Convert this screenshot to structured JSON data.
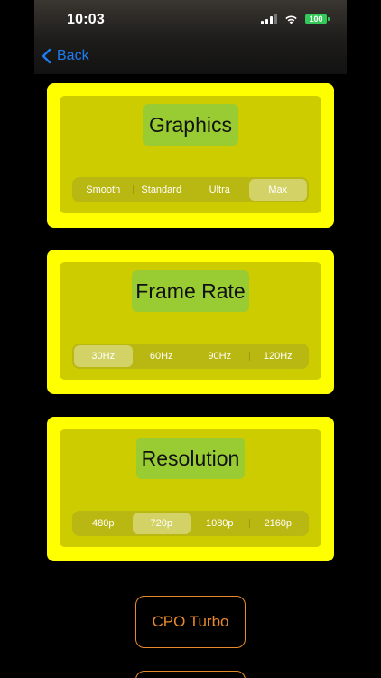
{
  "status": {
    "time": "10:03",
    "battery": "100"
  },
  "nav": {
    "back_label": "Back"
  },
  "sections": [
    {
      "title": "Graphics",
      "options": [
        "Smooth",
        "Standard",
        "Ultra",
        "Max"
      ],
      "selected": "Max"
    },
    {
      "title": "Frame Rate",
      "options": [
        "30Hz",
        "60Hz",
        "90Hz",
        "120Hz"
      ],
      "selected": "30Hz"
    },
    {
      "title": "Resolution",
      "options": [
        "480p",
        "720p",
        "1080p",
        "2160p"
      ],
      "selected": "720p"
    }
  ],
  "actions": {
    "turbo_label": "CPO Turbo"
  },
  "colors": {
    "card": "#ffff00",
    "card_inner": "#cccc00",
    "title_bg": "#99cc33",
    "accent_orange": "#e8892c",
    "link_blue": "#1e7cf2"
  },
  "icons": {
    "back": "chevron-left-icon",
    "signal": "cellular-signal-icon",
    "wifi": "wifi-icon",
    "battery": "battery-icon"
  }
}
